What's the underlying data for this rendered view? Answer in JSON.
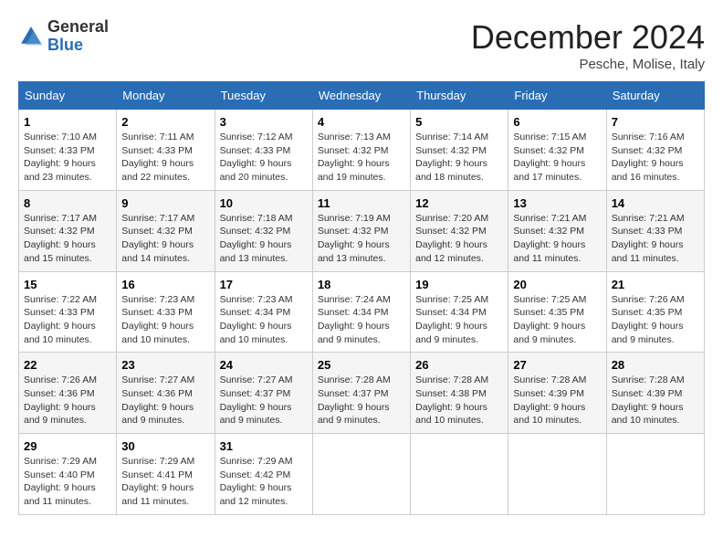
{
  "header": {
    "logo_line1": "General",
    "logo_line2": "Blue",
    "month_title": "December 2024",
    "location": "Pesche, Molise, Italy"
  },
  "weekdays": [
    "Sunday",
    "Monday",
    "Tuesday",
    "Wednesday",
    "Thursday",
    "Friday",
    "Saturday"
  ],
  "weeks": [
    [
      {
        "day": "1",
        "sunrise": "7:10 AM",
        "sunset": "4:33 PM",
        "daylight": "9 hours and 23 minutes."
      },
      {
        "day": "2",
        "sunrise": "7:11 AM",
        "sunset": "4:33 PM",
        "daylight": "9 hours and 22 minutes."
      },
      {
        "day": "3",
        "sunrise": "7:12 AM",
        "sunset": "4:33 PM",
        "daylight": "9 hours and 20 minutes."
      },
      {
        "day": "4",
        "sunrise": "7:13 AM",
        "sunset": "4:32 PM",
        "daylight": "9 hours and 19 minutes."
      },
      {
        "day": "5",
        "sunrise": "7:14 AM",
        "sunset": "4:32 PM",
        "daylight": "9 hours and 18 minutes."
      },
      {
        "day": "6",
        "sunrise": "7:15 AM",
        "sunset": "4:32 PM",
        "daylight": "9 hours and 17 minutes."
      },
      {
        "day": "7",
        "sunrise": "7:16 AM",
        "sunset": "4:32 PM",
        "daylight": "9 hours and 16 minutes."
      }
    ],
    [
      {
        "day": "8",
        "sunrise": "7:17 AM",
        "sunset": "4:32 PM",
        "daylight": "9 hours and 15 minutes."
      },
      {
        "day": "9",
        "sunrise": "7:17 AM",
        "sunset": "4:32 PM",
        "daylight": "9 hours and 14 minutes."
      },
      {
        "day": "10",
        "sunrise": "7:18 AM",
        "sunset": "4:32 PM",
        "daylight": "9 hours and 13 minutes."
      },
      {
        "day": "11",
        "sunrise": "7:19 AM",
        "sunset": "4:32 PM",
        "daylight": "9 hours and 13 minutes."
      },
      {
        "day": "12",
        "sunrise": "7:20 AM",
        "sunset": "4:32 PM",
        "daylight": "9 hours and 12 minutes."
      },
      {
        "day": "13",
        "sunrise": "7:21 AM",
        "sunset": "4:32 PM",
        "daylight": "9 hours and 11 minutes."
      },
      {
        "day": "14",
        "sunrise": "7:21 AM",
        "sunset": "4:33 PM",
        "daylight": "9 hours and 11 minutes."
      }
    ],
    [
      {
        "day": "15",
        "sunrise": "7:22 AM",
        "sunset": "4:33 PM",
        "daylight": "9 hours and 10 minutes."
      },
      {
        "day": "16",
        "sunrise": "7:23 AM",
        "sunset": "4:33 PM",
        "daylight": "9 hours and 10 minutes."
      },
      {
        "day": "17",
        "sunrise": "7:23 AM",
        "sunset": "4:34 PM",
        "daylight": "9 hours and 10 minutes."
      },
      {
        "day": "18",
        "sunrise": "7:24 AM",
        "sunset": "4:34 PM",
        "daylight": "9 hours and 9 minutes."
      },
      {
        "day": "19",
        "sunrise": "7:25 AM",
        "sunset": "4:34 PM",
        "daylight": "9 hours and 9 minutes."
      },
      {
        "day": "20",
        "sunrise": "7:25 AM",
        "sunset": "4:35 PM",
        "daylight": "9 hours and 9 minutes."
      },
      {
        "day": "21",
        "sunrise": "7:26 AM",
        "sunset": "4:35 PM",
        "daylight": "9 hours and 9 minutes."
      }
    ],
    [
      {
        "day": "22",
        "sunrise": "7:26 AM",
        "sunset": "4:36 PM",
        "daylight": "9 hours and 9 minutes."
      },
      {
        "day": "23",
        "sunrise": "7:27 AM",
        "sunset": "4:36 PM",
        "daylight": "9 hours and 9 minutes."
      },
      {
        "day": "24",
        "sunrise": "7:27 AM",
        "sunset": "4:37 PM",
        "daylight": "9 hours and 9 minutes."
      },
      {
        "day": "25",
        "sunrise": "7:28 AM",
        "sunset": "4:37 PM",
        "daylight": "9 hours and 9 minutes."
      },
      {
        "day": "26",
        "sunrise": "7:28 AM",
        "sunset": "4:38 PM",
        "daylight": "9 hours and 10 minutes."
      },
      {
        "day": "27",
        "sunrise": "7:28 AM",
        "sunset": "4:39 PM",
        "daylight": "9 hours and 10 minutes."
      },
      {
        "day": "28",
        "sunrise": "7:28 AM",
        "sunset": "4:39 PM",
        "daylight": "9 hours and 10 minutes."
      }
    ],
    [
      {
        "day": "29",
        "sunrise": "7:29 AM",
        "sunset": "4:40 PM",
        "daylight": "9 hours and 11 minutes."
      },
      {
        "day": "30",
        "sunrise": "7:29 AM",
        "sunset": "4:41 PM",
        "daylight": "9 hours and 11 minutes."
      },
      {
        "day": "31",
        "sunrise": "7:29 AM",
        "sunset": "4:42 PM",
        "daylight": "9 hours and 12 minutes."
      },
      null,
      null,
      null,
      null
    ]
  ]
}
